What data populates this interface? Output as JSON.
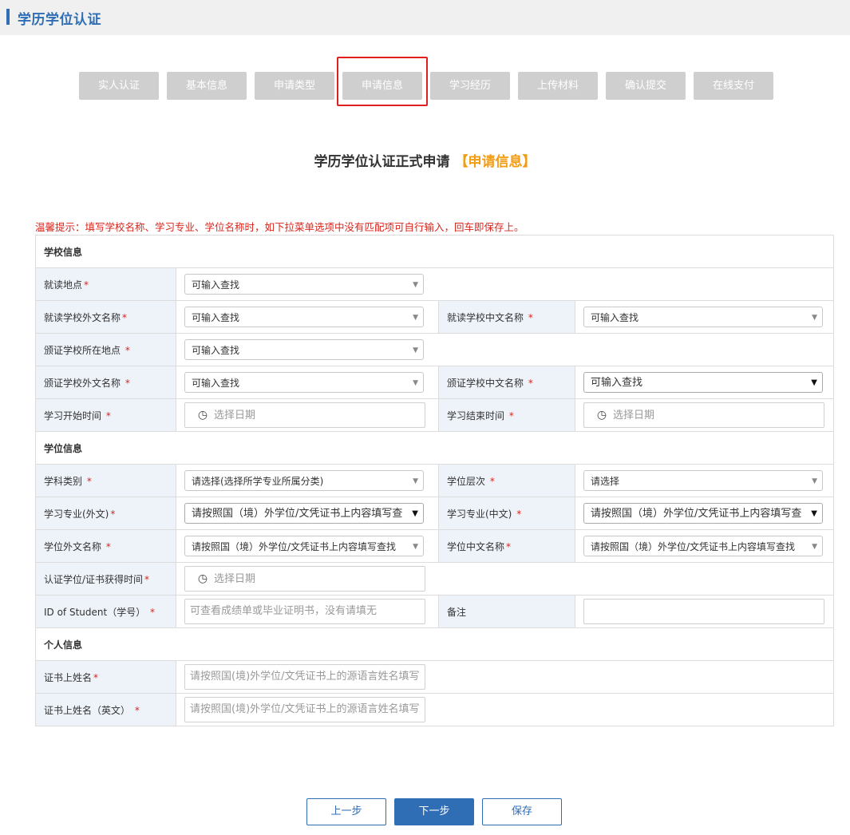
{
  "page_title": "学历学位认证",
  "steps": [
    "实人认证",
    "基本信息",
    "申请类型",
    "申请信息",
    "学习经历",
    "上传材料",
    "确认提交",
    "在线支付"
  ],
  "heading": {
    "main": "学历学位认证正式申请",
    "highlight": "【申请信息】"
  },
  "tip": "温馨提示：填写学校名称、学习专业、学位名称时，如下拉菜单选项中没有匹配项可自行输入，回车即保存上。",
  "sections": {
    "school": "学校信息",
    "degree": "学位信息",
    "personal": "个人信息"
  },
  "fields": {
    "study_location": {
      "label": "就读地点",
      "value": "可输入查找"
    },
    "school_foreign_name": {
      "label": "就读学校外文名称",
      "value": "可输入查找"
    },
    "school_chinese_name": {
      "label": "就读学校中文名称 ",
      "value": "可输入查找"
    },
    "issuing_school_location": {
      "label": "颁证学校所在地点 ",
      "value": "可输入查找"
    },
    "issuing_school_foreign_name": {
      "label": "颁证学校外文名称 ",
      "value": "可输入查找"
    },
    "issuing_school_chinese_name": {
      "label": "颁证学校中文名称 ",
      "value": "可输入查找"
    },
    "study_start": {
      "label": "学习开始时间 ",
      "placeholder": "选择日期"
    },
    "study_end": {
      "label": "学习结束时间 ",
      "placeholder": "选择日期"
    },
    "discipline": {
      "label": "学科类别 ",
      "value": "请选择(选择所学专业所属分类)"
    },
    "degree_level": {
      "label": "学位层次 ",
      "value": "请选择"
    },
    "major_foreign": {
      "label": "学习专业(外文)",
      "value": "请按照国（境）外学位/文凭证书上内容填写查"
    },
    "major_chinese": {
      "label": "学习专业(中文) ",
      "value": "请按照国（境）外学位/文凭证书上内容填写查"
    },
    "degree_foreign_name": {
      "label": "学位外文名称 ",
      "value": "请按照国（境）外学位/文凭证书上内容填写查找"
    },
    "degree_chinese_name": {
      "label": "学位中文名称",
      "value": "请按照国（境）外学位/文凭证书上内容填写查找"
    },
    "certificate_time": {
      "label": "认证学位/证书获得时间",
      "placeholder": "选择日期"
    },
    "student_id": {
      "label": "ID of Student（学号） ",
      "placeholder": "可查看成绩单或毕业证明书，没有请填无"
    },
    "remarks": {
      "label": "备注",
      "value": ""
    },
    "cert_name": {
      "label": "证书上姓名",
      "placeholder": "请按照国(境)外学位/文凭证书上的源语言姓名填写"
    },
    "cert_name_en": {
      "label": "证书上姓名（英文） ",
      "placeholder": "请按照国(境)外学位/文凭证书上的源语言姓名填写"
    }
  },
  "required_mark": "*",
  "icons": {
    "caret": "▼",
    "clock": "◷"
  },
  "buttons": {
    "prev": "上一步",
    "next": "下一步",
    "save": "保存"
  },
  "colors": {
    "accent": "#2f6db5",
    "highlight": "#f39c12",
    "warning": "#d9251c"
  }
}
